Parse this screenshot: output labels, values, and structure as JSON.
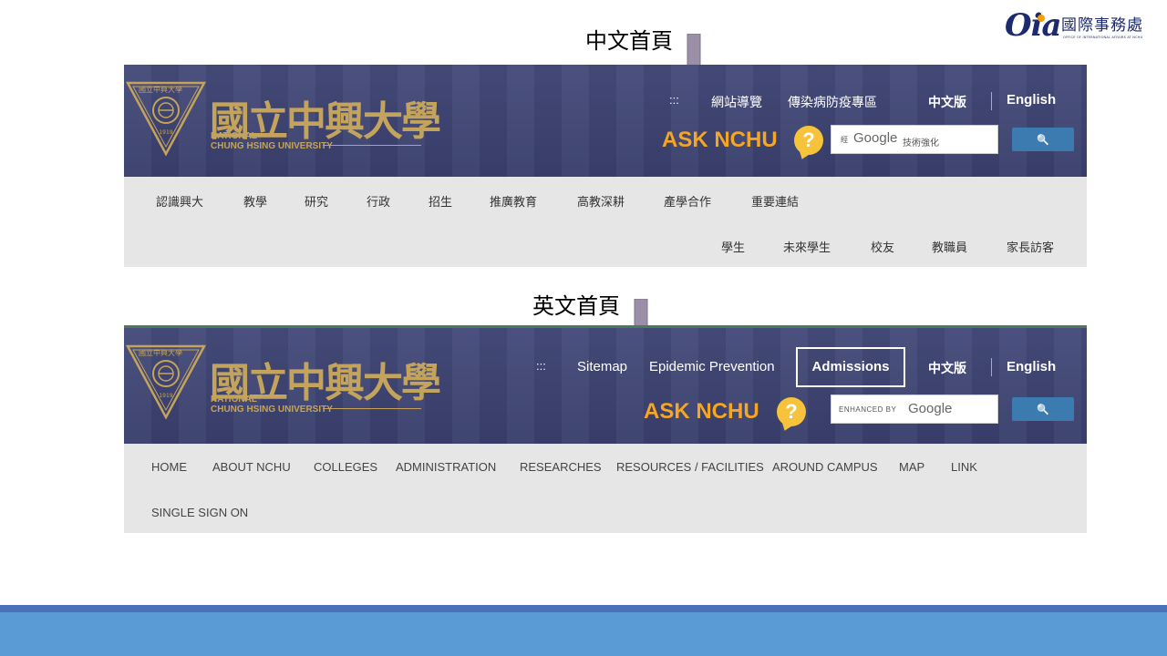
{
  "slide": {
    "label_chinese": "中文首頁",
    "label_english": "英文首頁"
  },
  "oia": {
    "letters": "Oia",
    "name_cn": "國際事務處",
    "name_en": "OFFICE OF INTERNATIONAL AFFAIRS AT NCHU"
  },
  "brand": {
    "name_cn": "國立中興大學",
    "name_en_line1": "NATIONAL",
    "name_en_line2": "CHUNG HSING UNIVERSITY",
    "emblem_text": "國立中興大學",
    "emblem_year": "1919"
  },
  "zh_site": {
    "top_links": {
      "dots": ":::",
      "sitemap": "網站導覽",
      "epidemic": "傳染病防疫專區",
      "lang_zh": "中文版",
      "lang_en": "English"
    },
    "ask": "ASK NCHU",
    "ask_icon": "?",
    "search": {
      "prefix": "經",
      "brand": "Google",
      "suffix": "技術強化",
      "button_icon": "🔍"
    },
    "nav_row1": [
      "認識興大",
      "教學",
      "研究",
      "行政",
      "招生",
      "推廣教育",
      "高教深耕",
      "產學合作",
      "重要連結"
    ],
    "nav_row2": [
      "學生",
      "未來學生",
      "校友",
      "教職員",
      "家長訪客"
    ]
  },
  "en_site": {
    "top_links": {
      "dots": ":::",
      "sitemap": "Sitemap",
      "epidemic": "Epidemic Prevention",
      "admissions": "Admissions",
      "lang_zh": "中文版",
      "lang_en": "English"
    },
    "ask": "ASK NCHU",
    "ask_icon": "?",
    "search": {
      "prefix": "ENHANCED BY",
      "brand": "Google",
      "button_icon": "🔍"
    },
    "nav_row1": [
      "HOME",
      "ABOUT NCHU",
      "COLLEGES",
      "ADMINISTRATION",
      "RESEARCHES",
      "RESOURCES / FACILITIES",
      "AROUND CAMPUS",
      "MAP",
      "LINK"
    ],
    "nav_row2": [
      "SINGLE SIGN ON"
    ]
  },
  "colors": {
    "header_bg": "#3e4475",
    "nav_bg": "#e6e6e6",
    "gold": "#c4a45c",
    "ask_orange": "#f5a623",
    "search_btn": "#3c7bb0",
    "arrow": "#9b8fa8",
    "footer": "#5b9bd5"
  }
}
